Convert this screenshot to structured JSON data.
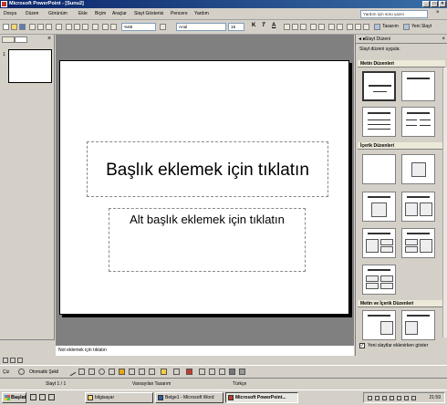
{
  "window": {
    "title": "Microsoft PowerPoint - [Sunu2]"
  },
  "menu": {
    "items": [
      "Dosya",
      "Düzen",
      "Görünüm",
      "Ekle",
      "Biçim",
      "Araçlar",
      "Slayt Gösterisi",
      "Pencere",
      "Yardım"
    ],
    "help_placeholder": "Yardım için soru yazın"
  },
  "toolbar": {
    "zoom": "%68",
    "font": "Arial",
    "font_size": "18",
    "bold": "K",
    "italic": "T",
    "underline": "A",
    "design_label": "Tasarım",
    "new_slide_label": "Yeni Slayt"
  },
  "slides_panel": {
    "slide_number": "1"
  },
  "slide": {
    "title_placeholder": "Başlık eklemek için tıklatın",
    "subtitle_placeholder": "Alt başlık eklemek için tıklatın"
  },
  "notes": {
    "placeholder": "Not eklemek için tıklatın"
  },
  "task_pane": {
    "title": "Slayt Düzeni",
    "apply_label": "Slayt düzeni uygula:",
    "sections": [
      "Metin Düzenleri",
      "İçerik Düzenleri",
      "Metin ve İçerik Düzenleri"
    ],
    "show_checkbox_label": "Yeni slaytlar eklenirken göster"
  },
  "drawing_toolbar": {
    "draw_label": "Çiz",
    "autoshapes_label": "Otomatik Şekil"
  },
  "status": {
    "slide": "Slayt 1 / 1",
    "design": "Varsayılan Tasarım",
    "language": "Türkçe"
  },
  "taskbar": {
    "start_label": "Başlat",
    "tasks": [
      "bilgisayar",
      "Belge1 - Microsoft Word",
      "Microsoft PowerPoint..."
    ],
    "clock": "21:59"
  }
}
